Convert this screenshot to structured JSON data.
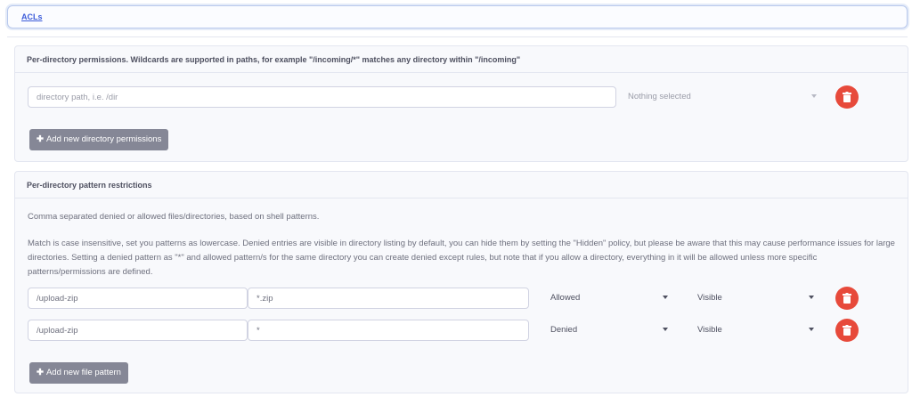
{
  "acl": {
    "link_label": "ACLs"
  },
  "dir_permissions": {
    "title": "Per-directory permissions. Wildcards are supported in paths, for example \"/incoming/*\" matches any directory within \"/incoming\"",
    "row": {
      "path_placeholder": "directory path, i.e. /dir",
      "permissions_value": "Nothing selected"
    },
    "add_button": "Add new directory permissions"
  },
  "patterns": {
    "title": "Per-directory pattern restrictions",
    "description_1": "Comma separated denied or allowed files/directories, based on shell patterns.",
    "description_2": "Match is case insensitive, set you patterns as lowercase. Denied entries are visible in directory listing by default, you can hide them by setting the \"Hidden\" policy, but please be aware that this may cause performance issues for large directories. Setting a denied pattern as \"*\" and allowed pattern/s for the same directory you can create denied except rules, but note that if you allow a directory, everything in it will be allowed unless more specific patterns/permissions are defined.",
    "rows": [
      {
        "path": "/upload-zip",
        "pattern": "*.zip",
        "type": "Allowed",
        "policy": "Visible"
      },
      {
        "path": "/upload-zip",
        "pattern": "*",
        "type": "Denied",
        "policy": "Visible"
      }
    ],
    "add_button": "Add new file pattern"
  },
  "colors": {
    "danger": "#e74a3b",
    "secondary": "#858796",
    "link": "#3b5bd9"
  },
  "icons": {
    "delete": "trash-icon",
    "add": "plus-icon",
    "dropdown": "caret-down-icon"
  }
}
